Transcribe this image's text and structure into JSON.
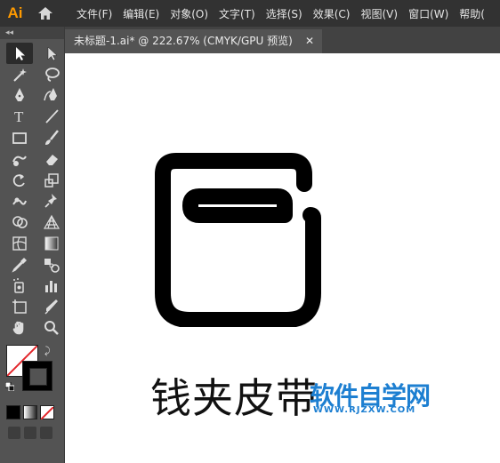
{
  "app": {
    "logo": "Ai"
  },
  "menu": {
    "items": [
      "文件(F)",
      "编辑(E)",
      "对象(O)",
      "文字(T)",
      "选择(S)",
      "效果(C)",
      "视图(V)",
      "窗口(W)",
      "帮助("
    ]
  },
  "toolbar": {
    "collapse_label": "◂◂",
    "tools": [
      {
        "name": "selection-tool",
        "icon": "arrow-icon"
      },
      {
        "name": "direct-selection-tool",
        "icon": "white-arrow-icon"
      },
      {
        "name": "magic-wand-tool",
        "icon": "magic-wand-icon"
      },
      {
        "name": "lasso-tool",
        "icon": "lasso-icon"
      },
      {
        "name": "pen-tool",
        "icon": "pen-icon"
      },
      {
        "name": "curvature-tool",
        "icon": "curvature-pen-icon"
      },
      {
        "name": "type-tool",
        "icon": "type-icon",
        "label": "T"
      },
      {
        "name": "line-tool",
        "icon": "line-icon"
      },
      {
        "name": "rectangle-tool",
        "icon": "rectangle-icon"
      },
      {
        "name": "paintbrush-tool",
        "icon": "brush-icon"
      },
      {
        "name": "shaper-tool",
        "icon": "shaper-icon"
      },
      {
        "name": "eraser-tool",
        "icon": "eraser-icon"
      },
      {
        "name": "rotate-tool",
        "icon": "rotate-icon"
      },
      {
        "name": "scale-tool",
        "icon": "scale-icon"
      },
      {
        "name": "warp-tool",
        "icon": "warp-icon"
      },
      {
        "name": "puppet-warp-tool",
        "icon": "pin-icon"
      },
      {
        "name": "shape-builder-tool",
        "icon": "shape-builder-icon"
      },
      {
        "name": "perspective-grid-tool",
        "icon": "perspective-grid-icon"
      },
      {
        "name": "mesh-tool",
        "icon": "mesh-icon"
      },
      {
        "name": "gradient-tool",
        "icon": "gradient-icon"
      },
      {
        "name": "eyedropper-tool",
        "icon": "eyedropper-icon"
      },
      {
        "name": "blend-tool",
        "icon": "blend-icon"
      },
      {
        "name": "symbol-sprayer-tool",
        "icon": "symbol-sprayer-icon"
      },
      {
        "name": "column-graph-tool",
        "icon": "bar-graph-icon"
      },
      {
        "name": "artboard-tool",
        "icon": "artboard-icon"
      },
      {
        "name": "slice-tool",
        "icon": "knife-icon"
      },
      {
        "name": "hand-tool",
        "icon": "hand-icon"
      },
      {
        "name": "zoom-tool",
        "icon": "magnifier-icon"
      }
    ]
  },
  "document": {
    "tab_title": "未标题-1.ai* @ 222.67% (CMYK/GPU 预览)",
    "close_label": "✕"
  },
  "artwork": {
    "caption": "钱夹皮带",
    "stroke_color": "#000000"
  },
  "watermark": {
    "title": "软件自学网",
    "url": "WWW.RJZXW.COM",
    "color": "#1d7fd1"
  },
  "colors": {
    "menubar": "#323232",
    "toolbar": "#535353",
    "logo": "#ff9a00"
  }
}
